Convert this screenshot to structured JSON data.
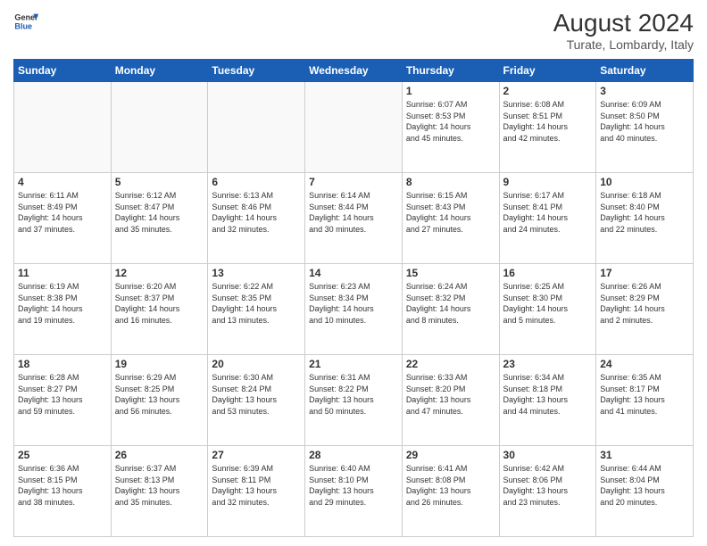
{
  "header": {
    "logo_line1": "General",
    "logo_line2": "Blue",
    "title": "August 2024",
    "subtitle": "Turate, Lombardy, Italy"
  },
  "days_of_week": [
    "Sunday",
    "Monday",
    "Tuesday",
    "Wednesday",
    "Thursday",
    "Friday",
    "Saturday"
  ],
  "weeks": [
    [
      {
        "day": "",
        "info": ""
      },
      {
        "day": "",
        "info": ""
      },
      {
        "day": "",
        "info": ""
      },
      {
        "day": "",
        "info": ""
      },
      {
        "day": "1",
        "info": "Sunrise: 6:07 AM\nSunset: 8:53 PM\nDaylight: 14 hours\nand 45 minutes."
      },
      {
        "day": "2",
        "info": "Sunrise: 6:08 AM\nSunset: 8:51 PM\nDaylight: 14 hours\nand 42 minutes."
      },
      {
        "day": "3",
        "info": "Sunrise: 6:09 AM\nSunset: 8:50 PM\nDaylight: 14 hours\nand 40 minutes."
      }
    ],
    [
      {
        "day": "4",
        "info": "Sunrise: 6:11 AM\nSunset: 8:49 PM\nDaylight: 14 hours\nand 37 minutes."
      },
      {
        "day": "5",
        "info": "Sunrise: 6:12 AM\nSunset: 8:47 PM\nDaylight: 14 hours\nand 35 minutes."
      },
      {
        "day": "6",
        "info": "Sunrise: 6:13 AM\nSunset: 8:46 PM\nDaylight: 14 hours\nand 32 minutes."
      },
      {
        "day": "7",
        "info": "Sunrise: 6:14 AM\nSunset: 8:44 PM\nDaylight: 14 hours\nand 30 minutes."
      },
      {
        "day": "8",
        "info": "Sunrise: 6:15 AM\nSunset: 8:43 PM\nDaylight: 14 hours\nand 27 minutes."
      },
      {
        "day": "9",
        "info": "Sunrise: 6:17 AM\nSunset: 8:41 PM\nDaylight: 14 hours\nand 24 minutes."
      },
      {
        "day": "10",
        "info": "Sunrise: 6:18 AM\nSunset: 8:40 PM\nDaylight: 14 hours\nand 22 minutes."
      }
    ],
    [
      {
        "day": "11",
        "info": "Sunrise: 6:19 AM\nSunset: 8:38 PM\nDaylight: 14 hours\nand 19 minutes."
      },
      {
        "day": "12",
        "info": "Sunrise: 6:20 AM\nSunset: 8:37 PM\nDaylight: 14 hours\nand 16 minutes."
      },
      {
        "day": "13",
        "info": "Sunrise: 6:22 AM\nSunset: 8:35 PM\nDaylight: 14 hours\nand 13 minutes."
      },
      {
        "day": "14",
        "info": "Sunrise: 6:23 AM\nSunset: 8:34 PM\nDaylight: 14 hours\nand 10 minutes."
      },
      {
        "day": "15",
        "info": "Sunrise: 6:24 AM\nSunset: 8:32 PM\nDaylight: 14 hours\nand 8 minutes."
      },
      {
        "day": "16",
        "info": "Sunrise: 6:25 AM\nSunset: 8:30 PM\nDaylight: 14 hours\nand 5 minutes."
      },
      {
        "day": "17",
        "info": "Sunrise: 6:26 AM\nSunset: 8:29 PM\nDaylight: 14 hours\nand 2 minutes."
      }
    ],
    [
      {
        "day": "18",
        "info": "Sunrise: 6:28 AM\nSunset: 8:27 PM\nDaylight: 13 hours\nand 59 minutes."
      },
      {
        "day": "19",
        "info": "Sunrise: 6:29 AM\nSunset: 8:25 PM\nDaylight: 13 hours\nand 56 minutes."
      },
      {
        "day": "20",
        "info": "Sunrise: 6:30 AM\nSunset: 8:24 PM\nDaylight: 13 hours\nand 53 minutes."
      },
      {
        "day": "21",
        "info": "Sunrise: 6:31 AM\nSunset: 8:22 PM\nDaylight: 13 hours\nand 50 minutes."
      },
      {
        "day": "22",
        "info": "Sunrise: 6:33 AM\nSunset: 8:20 PM\nDaylight: 13 hours\nand 47 minutes."
      },
      {
        "day": "23",
        "info": "Sunrise: 6:34 AM\nSunset: 8:18 PM\nDaylight: 13 hours\nand 44 minutes."
      },
      {
        "day": "24",
        "info": "Sunrise: 6:35 AM\nSunset: 8:17 PM\nDaylight: 13 hours\nand 41 minutes."
      }
    ],
    [
      {
        "day": "25",
        "info": "Sunrise: 6:36 AM\nSunset: 8:15 PM\nDaylight: 13 hours\nand 38 minutes."
      },
      {
        "day": "26",
        "info": "Sunrise: 6:37 AM\nSunset: 8:13 PM\nDaylight: 13 hours\nand 35 minutes."
      },
      {
        "day": "27",
        "info": "Sunrise: 6:39 AM\nSunset: 8:11 PM\nDaylight: 13 hours\nand 32 minutes."
      },
      {
        "day": "28",
        "info": "Sunrise: 6:40 AM\nSunset: 8:10 PM\nDaylight: 13 hours\nand 29 minutes."
      },
      {
        "day": "29",
        "info": "Sunrise: 6:41 AM\nSunset: 8:08 PM\nDaylight: 13 hours\nand 26 minutes."
      },
      {
        "day": "30",
        "info": "Sunrise: 6:42 AM\nSunset: 8:06 PM\nDaylight: 13 hours\nand 23 minutes."
      },
      {
        "day": "31",
        "info": "Sunrise: 6:44 AM\nSunset: 8:04 PM\nDaylight: 13 hours\nand 20 minutes."
      }
    ]
  ]
}
